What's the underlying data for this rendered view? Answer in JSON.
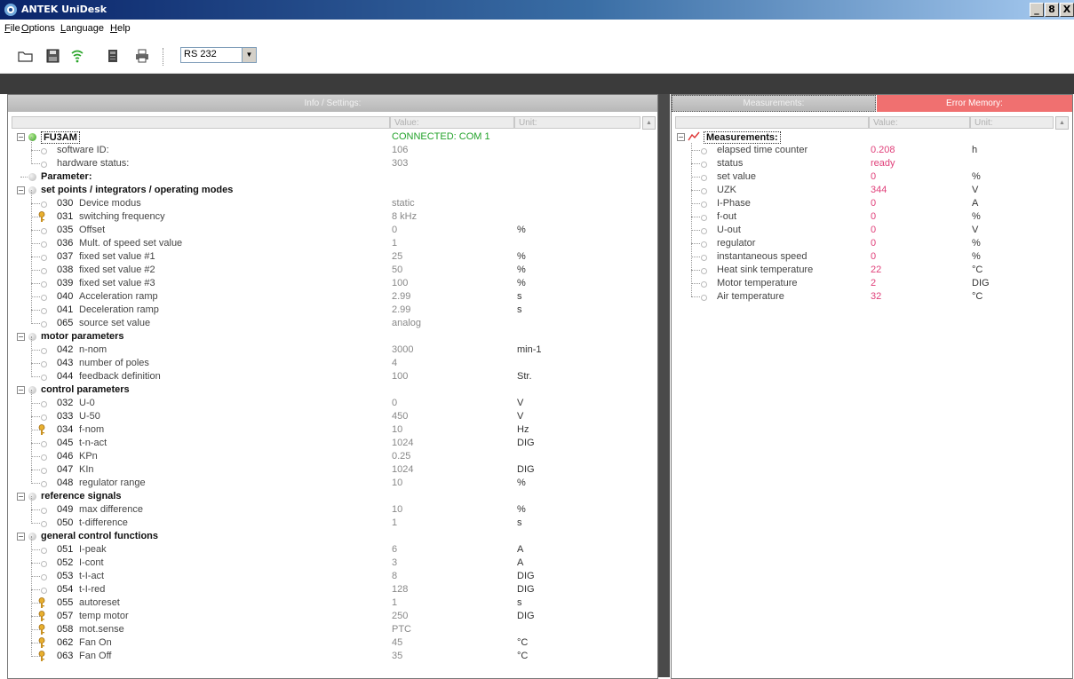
{
  "window": {
    "title": "ANTEK UniDesk",
    "controls": [
      "_",
      "8",
      "X"
    ]
  },
  "menu": [
    {
      "label": "File",
      "key": "F",
      "rest": "ile"
    },
    {
      "label": "Options",
      "key": "O",
      "rest": "ptions"
    },
    {
      "label": "Language",
      "key": "L",
      "rest": "anguage"
    },
    {
      "label": "Help",
      "key": "H",
      "rest": "elp"
    }
  ],
  "toolbar": {
    "icons": [
      "open-folder-icon",
      "save-disk-icon",
      "connect-signal-icon",
      "device-icon",
      "print-icon"
    ],
    "port": {
      "selected": "RS 232"
    }
  },
  "left_panel": {
    "header": "Info / Settings:",
    "columns": {
      "value": "Value:",
      "unit": "Unit:"
    },
    "device": {
      "name": "FU3AM",
      "status": "CONNECTED: COM 1"
    },
    "info_rows": [
      {
        "label": "software ID:",
        "value": "106",
        "unit": ""
      },
      {
        "label": "hardware status:",
        "value": "303",
        "unit": ""
      }
    ],
    "parameter_label": "Parameter:",
    "groups": [
      {
        "title": "set points / integrators / operating modes",
        "items": [
          {
            "num": "030",
            "label": "Device modus",
            "value": "static",
            "unit": "",
            "key": false
          },
          {
            "num": "031",
            "label": "switching frequency",
            "value": "8 kHz",
            "unit": "",
            "key": true
          },
          {
            "num": "035",
            "label": "Offset",
            "value": "0",
            "unit": "%",
            "key": false
          },
          {
            "num": "036",
            "label": "Mult. of speed set value",
            "value": "1",
            "unit": "",
            "key": false
          },
          {
            "num": "037",
            "label": "fixed set value #1",
            "value": "25",
            "unit": "%",
            "key": false
          },
          {
            "num": "038",
            "label": "fixed set value #2",
            "value": "50",
            "unit": "%",
            "key": false
          },
          {
            "num": "039",
            "label": "fixed set value #3",
            "value": "100",
            "unit": "%",
            "key": false
          },
          {
            "num": "040",
            "label": "Acceleration ramp",
            "value": "2.99",
            "unit": "s",
            "key": false
          },
          {
            "num": "041",
            "label": "Deceleration ramp",
            "value": "2.99",
            "unit": "s",
            "key": false
          },
          {
            "num": "065",
            "label": "source set value",
            "value": "analog",
            "unit": "",
            "key": false
          }
        ]
      },
      {
        "title": "motor parameters",
        "items": [
          {
            "num": "042",
            "label": "n-nom",
            "value": "3000",
            "unit": "min-1",
            "key": false
          },
          {
            "num": "043",
            "label": "number of poles",
            "value": "4",
            "unit": "",
            "key": false
          },
          {
            "num": "044",
            "label": "feedback definition",
            "value": "100",
            "unit": "Str.",
            "key": false
          }
        ]
      },
      {
        "title": "control parameters",
        "items": [
          {
            "num": "032",
            "label": "U-0",
            "value": "0",
            "unit": "V",
            "key": false
          },
          {
            "num": "033",
            "label": "U-50",
            "value": "450",
            "unit": "V",
            "key": false
          },
          {
            "num": "034",
            "label": "f-nom",
            "value": "10",
            "unit": "Hz",
            "key": true
          },
          {
            "num": "045",
            "label": "t-n-act",
            "value": "1024",
            "unit": "DIG",
            "key": false
          },
          {
            "num": "046",
            "label": "KPn",
            "value": "0.25",
            "unit": "",
            "key": false
          },
          {
            "num": "047",
            "label": "KIn",
            "value": "1024",
            "unit": "DIG",
            "key": false
          },
          {
            "num": "048",
            "label": "regulator range",
            "value": "10",
            "unit": "%",
            "key": false
          }
        ]
      },
      {
        "title": "reference signals",
        "items": [
          {
            "num": "049",
            "label": "max difference",
            "value": "10",
            "unit": "%",
            "key": false
          },
          {
            "num": "050",
            "label": "t-difference",
            "value": "1",
            "unit": "s",
            "key": false
          }
        ]
      },
      {
        "title": "general control functions",
        "items": [
          {
            "num": "051",
            "label": "I-peak",
            "value": "6",
            "unit": "A",
            "key": false
          },
          {
            "num": "052",
            "label": "I-cont",
            "value": "3",
            "unit": "A",
            "key": false
          },
          {
            "num": "053",
            "label": "t-I-act",
            "value": "8",
            "unit": "DIG",
            "key": false
          },
          {
            "num": "054",
            "label": "t-I-red",
            "value": "128",
            "unit": "DIG",
            "key": false
          },
          {
            "num": "055",
            "label": "autoreset",
            "value": "1",
            "unit": "s",
            "key": true
          },
          {
            "num": "057",
            "label": "temp motor",
            "value": "250",
            "unit": "DIG",
            "key": true
          },
          {
            "num": "058",
            "label": "mot.sense",
            "value": "PTC",
            "unit": "",
            "key": true
          },
          {
            "num": "062",
            "label": "Fan On",
            "value": "45",
            "unit": "°C",
            "key": true
          },
          {
            "num": "063",
            "label": "Fan Off",
            "value": "35",
            "unit": "°C",
            "key": true
          }
        ]
      }
    ]
  },
  "right_panel": {
    "tabs": {
      "measurements": "Measurements:",
      "errors": "Error Memory:"
    },
    "columns": {
      "value": "Value:",
      "unit": "Unit:"
    },
    "root": "Measurements:",
    "items": [
      {
        "label": "elapsed time counter",
        "value": "0.208",
        "unit": "h"
      },
      {
        "label": "status",
        "value": "ready",
        "unit": ""
      },
      {
        "label": "set value",
        "value": "0",
        "unit": "%"
      },
      {
        "label": "UZK",
        "value": "344",
        "unit": "V"
      },
      {
        "label": "I-Phase",
        "value": "0",
        "unit": "A"
      },
      {
        "label": "f-out",
        "value": "0",
        "unit": "%"
      },
      {
        "label": "U-out",
        "value": "0",
        "unit": "V"
      },
      {
        "label": "regulator",
        "value": "0",
        "unit": "%"
      },
      {
        "label": "instantaneous speed",
        "value": "0",
        "unit": "%"
      },
      {
        "label": "Heat sink temperature",
        "value": "22",
        "unit": "°C"
      },
      {
        "label": "Motor temperature",
        "value": "2",
        "unit": "DIG"
      },
      {
        "label": "Air temperature",
        "value": "32",
        "unit": "°C"
      }
    ]
  }
}
